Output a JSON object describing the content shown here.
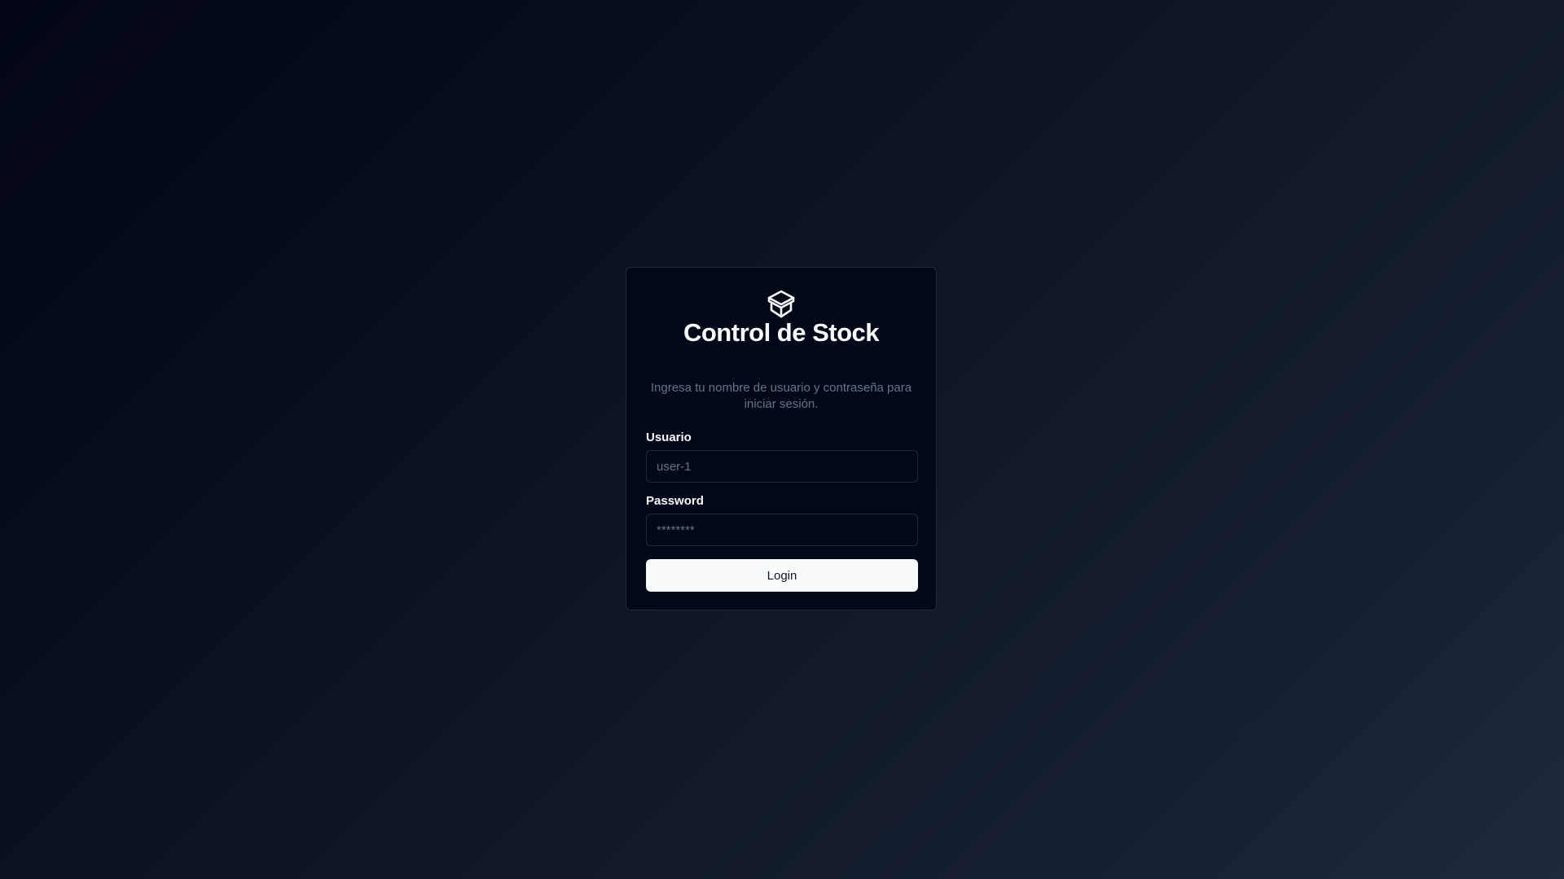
{
  "app": {
    "logo_icon": "package-box-icon",
    "title": "Control de Stock",
    "subtitle": "Ingresa tu nombre de usuario y contraseña para iniciar sesión."
  },
  "form": {
    "username_label": "Usuario",
    "username_placeholder": "user-1",
    "username_value": "",
    "password_label": "Password",
    "password_placeholder": "********",
    "password_value": "",
    "login_label": "Login"
  },
  "colors": {
    "card_background": "#020817",
    "border": "#1e293b",
    "text_primary": "#f8fafc",
    "text_muted": "#64748b",
    "button_background": "#f8fafc",
    "button_text": "#0f172a"
  }
}
